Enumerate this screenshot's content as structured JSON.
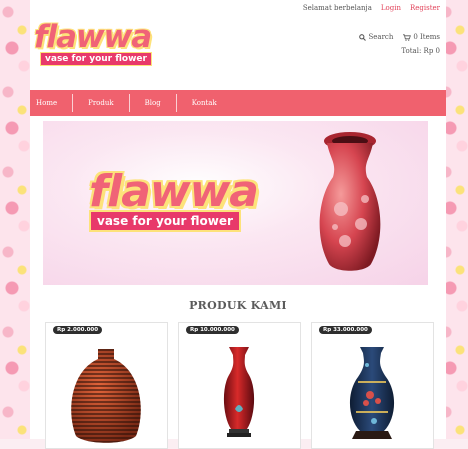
{
  "header": {
    "greeting": "Selamat berbelanja",
    "login_label": "Login",
    "register_label": "Register",
    "logo_word": "flawwa",
    "logo_tagline": "vase for your flower",
    "search_label": "Search",
    "cart_label": "0 Items",
    "total_label": "Total: Rp 0"
  },
  "nav": {
    "items": [
      {
        "label": "Home"
      },
      {
        "label": "Produk"
      },
      {
        "label": "Blog"
      },
      {
        "label": "Kontak"
      }
    ]
  },
  "banner": {
    "word": "flawwa",
    "tagline": "vase for your flower"
  },
  "products": {
    "title": "PRODUK KAMI",
    "items": [
      {
        "price": "Rp 2.000.000"
      },
      {
        "price": "Rp 10.000.000"
      },
      {
        "price": "Rp 33.000.000"
      }
    ]
  },
  "icons": {
    "search": "search-icon",
    "cart": "cart-icon"
  },
  "colors": {
    "accent": "#f0616e",
    "logo_pink": "#f06377",
    "logo_yellow": "#fde27a",
    "tag_bg": "#e8396a"
  }
}
